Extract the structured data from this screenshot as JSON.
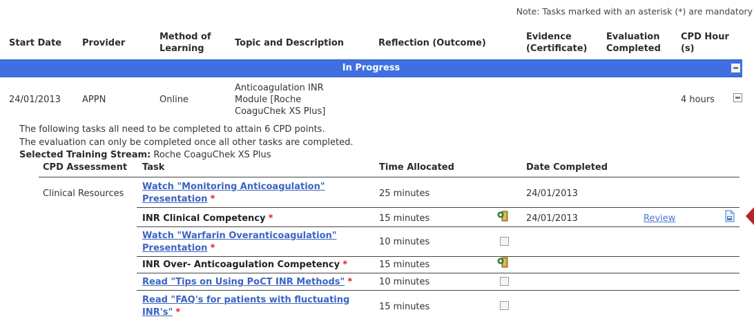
{
  "note": "Note: Tasks marked with an asterisk (*) are mandatory",
  "columns": {
    "start_date": "Start Date",
    "provider": "Provider",
    "method": "Method of Learning",
    "topic": "Topic and Description",
    "reflection": "Reflection (Outcome)",
    "evidence": "Evidence (Certificate)",
    "evaluation": "Evaluation Completed",
    "cpd_hours": "CPD Hour (s)"
  },
  "section_title": "In Progress",
  "record": {
    "start_date": "24/01/2013",
    "provider": "APPN",
    "method": "Online",
    "topic": "Anticoagulation INR Module [Roche CoaguChek XS Plus]",
    "hours": "4 hours"
  },
  "info": {
    "line1": "The following tasks all need to be completed to attain 6 CPD points.",
    "line2": "The evaluation can only be completed once all other tasks are completed.",
    "stream_label": "Selected Training Stream:",
    "stream_value": "Roche CoaguChek XS Plus"
  },
  "task_columns": {
    "assessment": "CPD Assessment",
    "task": "Task",
    "time": "Time Allocated",
    "date": "Date Completed"
  },
  "tasks": [
    {
      "assessment": "Clinical Resources",
      "line1": "Watch \"Monitoring Anticoagulation\"",
      "line2": "Presentation",
      "mandatory": "*",
      "time": "25 minutes",
      "date": "24/01/2013"
    },
    {
      "assessment": "",
      "line1": "INR Clinical Competency",
      "mandatory": "*",
      "time": "15 minutes",
      "date": "24/01/2013",
      "action": "Review"
    },
    {
      "assessment": "",
      "line1": "Watch \"Warfarin Overanticoagulation\"",
      "line2": "Presentation",
      "mandatory": "*",
      "time": "10 minutes",
      "date": ""
    },
    {
      "assessment": "",
      "line1": "INR Over- Anticoagulation Competency",
      "mandatory": "*",
      "time": "15 minutes",
      "date": ""
    },
    {
      "assessment": "",
      "line1": "Read \"Tips on Using PoCT INR Methods\"",
      "mandatory": "*",
      "time": "10 minutes",
      "date": ""
    },
    {
      "assessment": "",
      "line1": "Read \"FAQ's for patients with fluctuating",
      "line2": "INR's\"",
      "mandatory": "*",
      "time": "15 minutes",
      "date": ""
    }
  ],
  "icons": {
    "collapse": "collapse-icon",
    "competency": "competency-flag-icon",
    "document": "document-icon",
    "pointer": "pointer-arrow-icon"
  },
  "colors": {
    "band": "#3f6fe0",
    "link": "#3a64c2",
    "asterisk": "#e02020",
    "arrow": "#b3262e"
  }
}
